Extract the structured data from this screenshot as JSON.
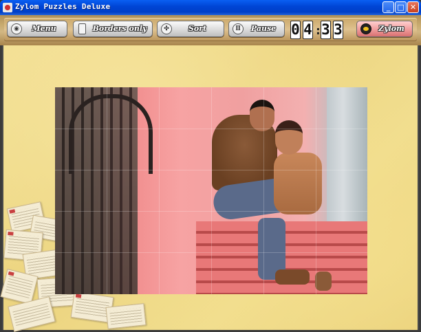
{
  "window": {
    "title": "Zylom Puzzles Deluxe",
    "controls": [
      "minimize",
      "maximize",
      "close"
    ]
  },
  "toolbar": {
    "menu_label": "Menu",
    "borders_label": "Borders only",
    "sort_label": "Sort",
    "pause_label": "Pause",
    "zylom_label": "Zylom"
  },
  "timer": {
    "minutes": [
      "0",
      "4"
    ],
    "seconds": [
      "3",
      "3"
    ],
    "separator": ":"
  },
  "colors": {
    "titlebar": "#0044d4",
    "toolbar": "#c7a96e",
    "board_background": "#ecd47f",
    "zylom_button": "#f2a0a0"
  },
  "icons": {
    "menu": "eye-icon",
    "borders": "square-icon",
    "sort": "jigsaw-icon",
    "pause": "pause-icon",
    "zylom": "zylom-logo-icon"
  }
}
